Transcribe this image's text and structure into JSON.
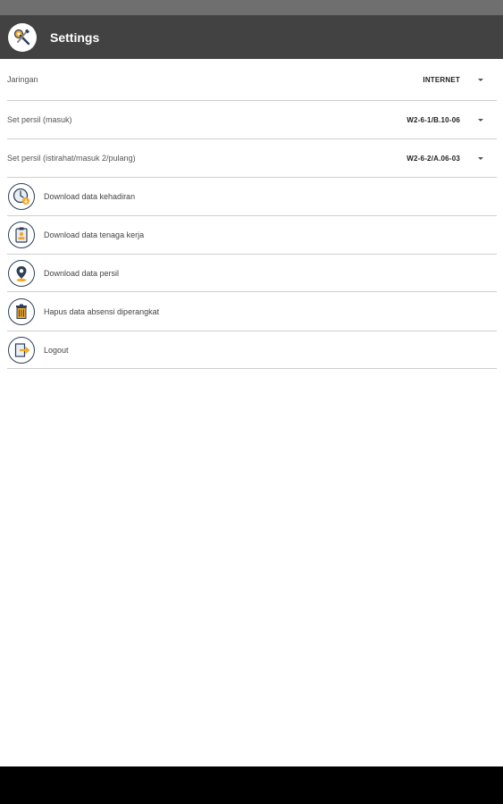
{
  "app": {
    "title": "Settings"
  },
  "settings": {
    "network": {
      "label": "Jaringan",
      "value": "INTERNET"
    },
    "persil_in": {
      "label": "Set persil (masuk)",
      "value": "W2-6-1/B.10-06"
    },
    "persil_break": {
      "label": "Set persil (istirahat/masuk 2/pulang)",
      "value": "W2-6-2/A.06-03"
    }
  },
  "actions": [
    {
      "label": "Download data kehadiran",
      "icon": "clock-download-icon"
    },
    {
      "label": "Download data tenaga kerja",
      "icon": "clipboard-worker-icon"
    },
    {
      "label": "Download data persil",
      "icon": "map-pin-icon"
    },
    {
      "label": "Hapus data absensi diperangkat",
      "icon": "trash-icon"
    },
    {
      "label": "Logout",
      "icon": "logout-icon"
    }
  ],
  "colors": {
    "app_bar": "#424242",
    "status_bar": "#6f6f6f",
    "divider": "#cfcfcf",
    "icon_outline": "#2c3e5a",
    "accent_orange": "#f5a623"
  }
}
